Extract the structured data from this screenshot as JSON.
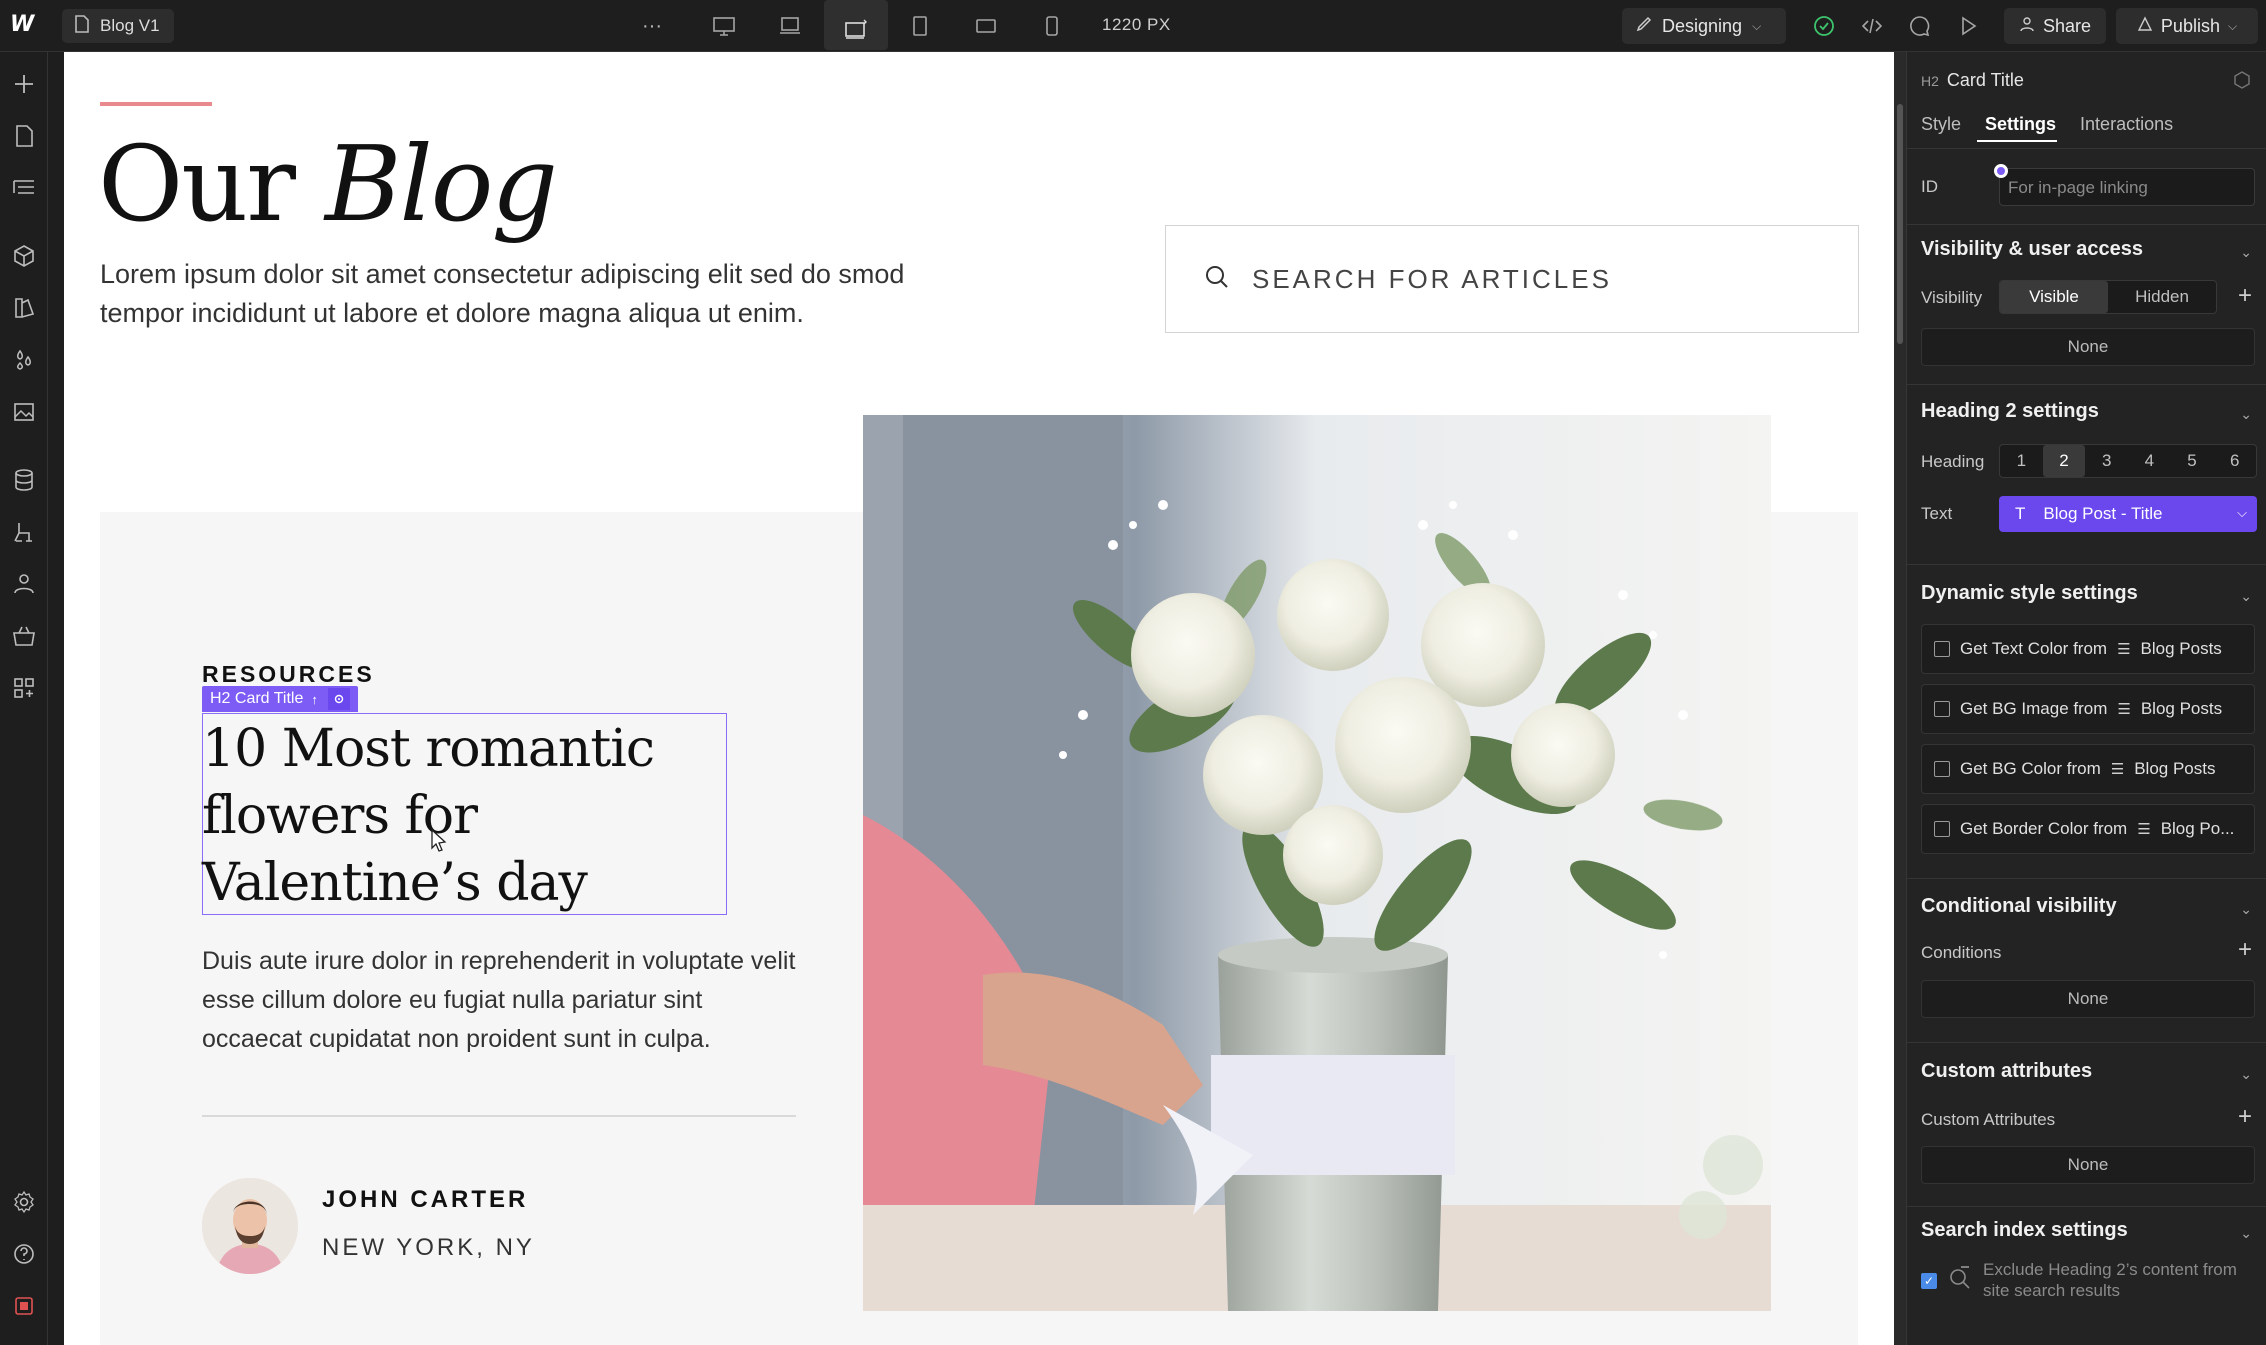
{
  "topbar": {
    "page_name": "Blog V1",
    "more_label": "···",
    "canvas_width": "1220 PX",
    "mode_label": "Designing",
    "share_label": "Share",
    "publish_label": "Publish"
  },
  "canvas": {
    "title_plain": "Our",
    "title_italic": "Blog",
    "intro": "Lorem ipsum dolor sit amet consectetur adipiscing elit sed do smod tempor incididunt ut labore et dolore magna aliqua ut enim.",
    "search_placeholder": "SEARCH FOR ARTICLES",
    "card": {
      "category": "RESOURCES",
      "selection_tag": "H2 Card Title",
      "title": "10 Most romantic flowers for Valentine’s day",
      "description": "Duis aute irure dolor in reprehenderit in voluptate velit esse cillum dolore eu fugiat nulla pariatur sint occaecat cupidatat non proident sunt in culpa.",
      "author_name": "JOHN CARTER",
      "author_location": "NEW YORK, NY"
    }
  },
  "panel": {
    "element_tag": "H2",
    "element_name": "Card Title",
    "tabs": [
      "Style",
      "Settings",
      "Interactions"
    ],
    "active_tab": "Settings",
    "id_label": "ID",
    "id_placeholder": "For in-page linking",
    "visibility": {
      "title": "Visibility & user access",
      "label": "Visibility",
      "options": [
        "Visible",
        "Hidden"
      ],
      "selected": "Visible",
      "none_label": "None"
    },
    "heading": {
      "title": "Heading 2 settings",
      "heading_label": "Heading",
      "levels": [
        "1",
        "2",
        "3",
        "4",
        "5",
        "6"
      ],
      "selected_level": "2",
      "text_label": "Text",
      "text_icon": "T",
      "text_value": "Blog Post - Title"
    },
    "dynamic": {
      "title": "Dynamic style settings",
      "rows": [
        {
          "label": "Get Text Color from",
          "source": "Blog Posts"
        },
        {
          "label": "Get BG Image from",
          "source": "Blog Posts"
        },
        {
          "label": "Get BG Color from",
          "source": "Blog Posts"
        },
        {
          "label": "Get Border Color from",
          "source": "Blog Po..."
        }
      ]
    },
    "conditional": {
      "title": "Conditional visibility",
      "label": "Conditions",
      "none_label": "None"
    },
    "custom_attributes": {
      "title": "Custom attributes",
      "label": "Custom Attributes",
      "none_label": "None"
    },
    "search_index": {
      "title": "Search index settings",
      "checkbox_label": "Exclude Heading 2’s content from site search results"
    }
  },
  "colors": {
    "accent": "#7c5cf5",
    "accent_strong": "#6b47ee",
    "title_rule": "#e8898e",
    "panel_bg": "#232323",
    "topbar_bg": "#1e1e1e"
  },
  "icons": {
    "rail": [
      "add-icon",
      "pages-icon",
      "navigator-icon",
      "components-icon",
      "styles-icon",
      "variables-icon",
      "assets-icon",
      "cms-icon",
      "logic-icon",
      "users-icon",
      "ecommerce-icon",
      "apps-icon",
      "settings-icon",
      "help-icon",
      "record-icon"
    ],
    "topbar": [
      "webflow-logo-icon",
      "page-icon",
      "desktop-icon",
      "laptop-icon",
      "tablet-wide-icon",
      "tablet-icon",
      "tablet-landscape-icon",
      "mobile-icon",
      "brush-icon",
      "check-icon",
      "code-icon",
      "comment-icon",
      "play-icon",
      "user-icon",
      "publish-icon"
    ]
  }
}
